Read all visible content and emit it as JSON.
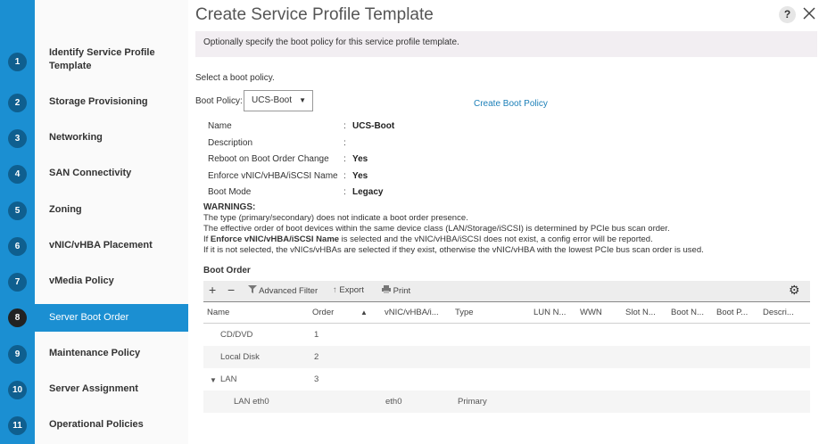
{
  "sidebar": {
    "steps": [
      {
        "num": "1",
        "label": "Identify Service Profile Template"
      },
      {
        "num": "2",
        "label": "Storage Provisioning"
      },
      {
        "num": "3",
        "label": "Networking"
      },
      {
        "num": "4",
        "label": "SAN Connectivity"
      },
      {
        "num": "5",
        "label": "Zoning"
      },
      {
        "num": "6",
        "label": "vNIC/vHBA Placement"
      },
      {
        "num": "7",
        "label": "vMedia Policy"
      },
      {
        "num": "8",
        "label": "Server Boot Order"
      },
      {
        "num": "9",
        "label": "Maintenance Policy"
      },
      {
        "num": "10",
        "label": "Server Assignment"
      },
      {
        "num": "11",
        "label": "Operational Policies"
      }
    ],
    "active_step": "8"
  },
  "header": {
    "title": "Create Service Profile Template",
    "help_icon": "?"
  },
  "banner": "Optionally specify the boot policy for this service profile template.",
  "select_prompt": "Select a boot policy.",
  "boot_policy": {
    "label": "Boot Policy:",
    "selected": "UCS-Boot",
    "create_link": "Create Boot Policy"
  },
  "properties": [
    {
      "label": "Name",
      "value": "UCS-Boot"
    },
    {
      "label": "Description",
      "value": ""
    },
    {
      "label": "Reboot on Boot Order Change",
      "value": "Yes"
    },
    {
      "label": "Enforce vNIC/vHBA/iSCSI Name",
      "value": "Yes"
    },
    {
      "label": "Boot Mode",
      "value": "Legacy"
    }
  ],
  "warnings": {
    "title": "WARNINGS:",
    "line1": "The type (primary/secondary) does not indicate a boot order presence.",
    "line2": "The effective order of boot devices within the same device class (LAN/Storage/iSCSI) is determined by PCIe bus scan order.",
    "line3_pre": "If ",
    "line3_bold": "Enforce vNIC/vHBA/iSCSI Name",
    "line3_post": " is selected and the vNIC/vHBA/iSCSI does not exist, a config error will be reported.",
    "line4": "If it is not selected, the vNICs/vHBAs are selected if they exist, otherwise the vNIC/vHBA with the lowest PCIe bus scan order is used."
  },
  "boot_order": {
    "title": "Boot Order",
    "toolbar": {
      "add": "+",
      "remove": "−",
      "advanced_filter": "Advanced Filter",
      "export": "Export",
      "print": "Print"
    },
    "columns": [
      "Name",
      "Order",
      "vNIC/vHBA/i...",
      "Type",
      "LUN N...",
      "WWN",
      "Slot N...",
      "Boot N...",
      "Boot P...",
      "Descri..."
    ],
    "rows": [
      {
        "name": "CD/DVD",
        "order": "1",
        "vnic": "",
        "type": ""
      },
      {
        "name": "Local Disk",
        "order": "2",
        "vnic": "",
        "type": ""
      },
      {
        "name": "LAN",
        "order": "3",
        "vnic": "",
        "type": ""
      },
      {
        "name": "LAN eth0",
        "order": "",
        "vnic": "eth0",
        "type": "Primary"
      }
    ]
  }
}
